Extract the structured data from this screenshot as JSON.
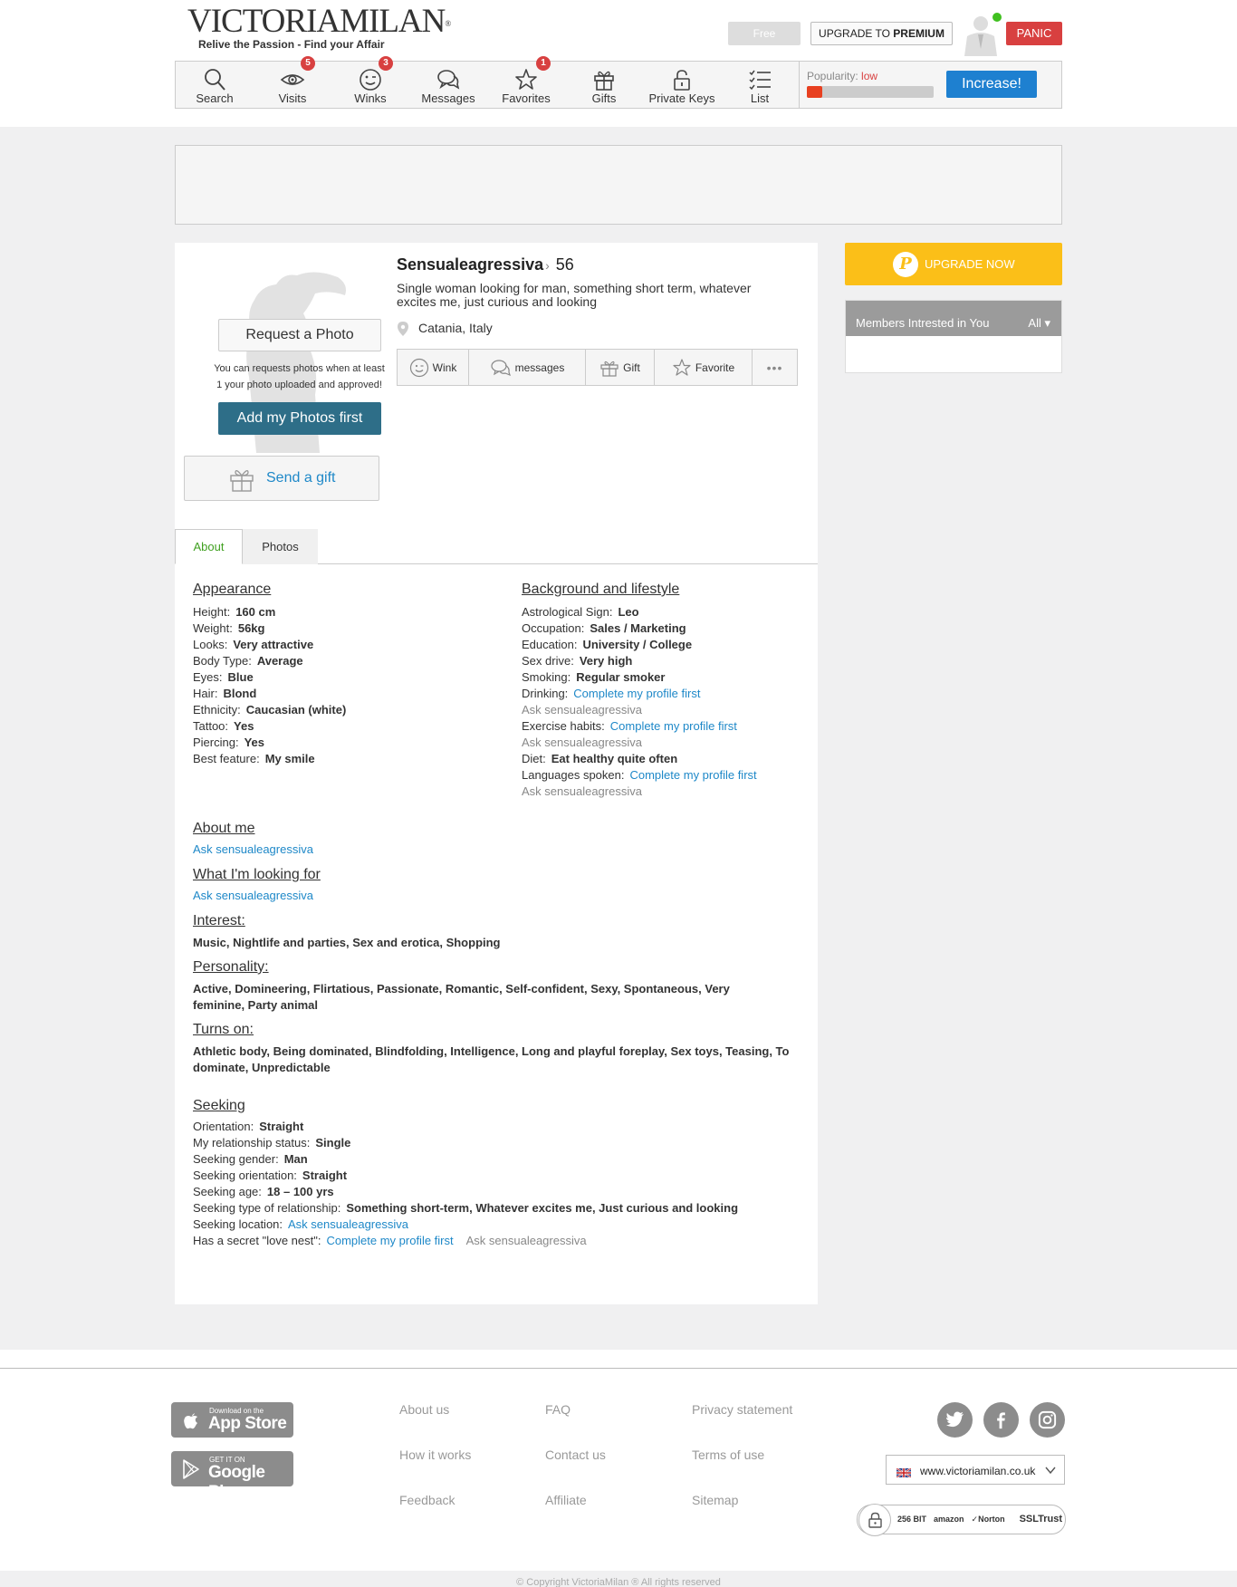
{
  "brand": {
    "logo_text": "VICTORIAMILAN",
    "registered": "®",
    "tagline": "Relive the Passion - Find your Affair"
  },
  "header": {
    "free_label": "Free",
    "upgrade_prefix": "UPGRADE TO ",
    "upgrade_bold": "PREMIUM",
    "panic_label": "PANIC"
  },
  "nav": {
    "items": [
      {
        "label": "Search",
        "icon": "search-icon",
        "badge": ""
      },
      {
        "label": "Visits",
        "icon": "eye-icon",
        "badge": "5"
      },
      {
        "label": "Winks",
        "icon": "wink-face-icon",
        "badge": "3"
      },
      {
        "label": "Messages",
        "icon": "chat-bubbles-icon",
        "badge": ""
      },
      {
        "label": "Favorites",
        "icon": "star-icon",
        "badge": "1"
      },
      {
        "label": "Gifts",
        "icon": "gift-icon",
        "badge": ""
      },
      {
        "label": "Private Keys",
        "icon": "padlock-icon",
        "badge": ""
      },
      {
        "label": "List",
        "icon": "checklist-icon",
        "badge": ""
      }
    ],
    "popularity_label": "Popularity:",
    "popularity_value": "low",
    "popularity_level": 0.12,
    "increase_label": "Increase!"
  },
  "profile": {
    "name": "Sensualeagressiva",
    "separator": "›",
    "age": "56",
    "description": "Single woman looking for man, something short term, whatever excites me, just curious and looking",
    "location": "Catania, Italy",
    "request_photo_label": "Request a Photo",
    "request_photo_note": "You can requests photos when at least 1 your photo uploaded and approved!",
    "add_photos_label": "Add my Photos first",
    "send_gift_label": "Send a gift",
    "actions": {
      "wink": "Wink",
      "messages": "messages",
      "gift": "Gift",
      "favorite": "Favorite",
      "more": "•••"
    }
  },
  "tabs": {
    "about": "About",
    "photos": "Photos"
  },
  "appearance": {
    "title": "Appearance",
    "rows": [
      {
        "k": "Height:",
        "v": "160 cm"
      },
      {
        "k": "Weight:",
        "v": "56kg"
      },
      {
        "k": "Looks:",
        "v": "Very attractive"
      },
      {
        "k": "Body Type:",
        "v": "Average"
      },
      {
        "k": "Eyes:",
        "v": "Blue"
      },
      {
        "k": "Hair:",
        "v": "Blond"
      },
      {
        "k": "Ethnicity:",
        "v": "Caucasian (white)"
      },
      {
        "k": "Tattoo:",
        "v": "Yes"
      },
      {
        "k": "Piercing:",
        "v": "Yes"
      },
      {
        "k": "Best feature:",
        "v": "My smile"
      }
    ]
  },
  "background": {
    "title": "Background and lifestyle",
    "rows": [
      {
        "k": "Astrological Sign:",
        "v": "Leo"
      },
      {
        "k": "Occupation:",
        "v": "Sales / Marketing"
      },
      {
        "k": "Education:",
        "v": "University / College"
      },
      {
        "k": "Sex drive:",
        "v": "Very high"
      },
      {
        "k": "Smoking:",
        "v": "Regular smoker"
      }
    ],
    "drinking_k": "Drinking:",
    "drinking_link": "Complete my profile first",
    "drinking_ask": "Ask sensualeagressiva",
    "exercise_k": "Exercise habits:",
    "exercise_link": "Complete my profile first",
    "exercise_ask": "Ask sensualeagressiva",
    "diet_k": "Diet:",
    "diet_v": "Eat healthy quite often",
    "languages_k": "Languages spoken:",
    "languages_link": "Complete my profile first",
    "languages_ask": "Ask sensualeagressiva"
  },
  "about_me": {
    "title": "About me",
    "ask": "Ask sensualeagressiva"
  },
  "looking_for": {
    "title": "What I'm looking for",
    "ask": "Ask sensualeagressiva"
  },
  "interest": {
    "title": "Interest:",
    "text": "Music, Nightlife and parties, Sex and erotica, Shopping"
  },
  "personality": {
    "title": "Personality:",
    "text": "Active, Domineering, Flirtatious, Passionate, Romantic, Self-confident, Sexy, Spontaneous, Very feminine, Party animal"
  },
  "turns_on": {
    "title": "Turns on:",
    "text": "Athletic body, Being dominated, Blindfolding, Intelligence, Long and playful foreplay, Sex toys, Teasing, To dominate, Unpredictable"
  },
  "seeking": {
    "title": "Seeking",
    "rows": [
      {
        "k": "Orientation:",
        "v": "Straight"
      },
      {
        "k": "My relationship status:",
        "v": "Single"
      },
      {
        "k": "Seeking gender:",
        "v": "Man"
      },
      {
        "k": "Seeking orientation:",
        "v": "Straight"
      },
      {
        "k": "Seeking age:",
        "v": "18 – 100 yrs"
      },
      {
        "k": "Seeking type of relationship:",
        "v": "Something short-term, Whatever excites me, Just curious and looking"
      }
    ],
    "location_k": "Seeking location:",
    "location_link": "Ask sensualeagressiva",
    "nest_k": "Has a secret \"love nest\":",
    "nest_link": "Complete my profile first",
    "nest_ask": "Ask sensualeagressiva"
  },
  "sidebar": {
    "upgrade_now": "UPGRADE NOW",
    "members_title": "Members Intrested in You",
    "members_filter": "All ▾"
  },
  "footer": {
    "appstore_small": "Download on the",
    "appstore_big": "App Store",
    "googleplay_small": "GET IT ON",
    "googleplay_big": "Google Play",
    "links": {
      "about": "About us",
      "how": "How it works",
      "feedback": "Feedback",
      "faq": "FAQ",
      "contact": "Contact us",
      "affiliate": "Affiliate",
      "privacy": "Privacy statement",
      "terms": "Terms of use",
      "sitemap": "Sitemap"
    },
    "site": "www.victoriamilan.co.uk",
    "trust_encryption": "256 BIT",
    "trust_amazon": "amazon",
    "trust_norton": "Norton",
    "trust_ssl": "SSLTrust",
    "copyright": "© Copyright VictoriaMilan ® All rights reserved"
  },
  "colors": {
    "accent_blue": "#1e80d0",
    "panic_red": "#d84040",
    "upgrade_yellow": "#fbbf18",
    "active_tab_green": "#40a020",
    "link_blue": "#1e88c8"
  }
}
